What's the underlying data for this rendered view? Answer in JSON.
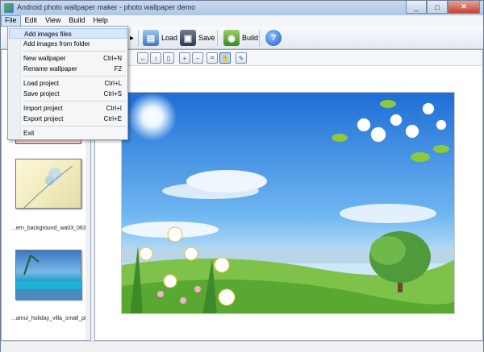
{
  "window": {
    "title": "Android photo wallpaper maker - photo wallpaper demo"
  },
  "menubar": {
    "items": [
      "File",
      "Edit",
      "View",
      "Build",
      "Help"
    ]
  },
  "toolbar": {
    "load_label": "Load",
    "save_label": "Save",
    "build_label": "Build"
  },
  "file_menu": {
    "items": [
      {
        "label": "Add images files",
        "shortcut": ""
      },
      {
        "label": "Add images from folder",
        "shortcut": ""
      },
      {
        "label": "New wallpaper",
        "shortcut": "Ctrl+N"
      },
      {
        "label": "Rename wallpaper",
        "shortcut": "F2"
      },
      {
        "label": "Load project",
        "shortcut": "Ctrl+L"
      },
      {
        "label": "Save project",
        "shortcut": "Ctrl+S"
      },
      {
        "label": "Import project",
        "shortcut": "Ctrl+I"
      },
      {
        "label": "Export project",
        "shortcut": "Ctrl+E"
      },
      {
        "label": "Exit",
        "shortcut": ""
      }
    ]
  },
  "thumbnails": [
    {
      "caption": "...ern_background_wa03_063l"
    },
    {
      "caption": "...amui_holiday_villa_small_pic"
    }
  ]
}
